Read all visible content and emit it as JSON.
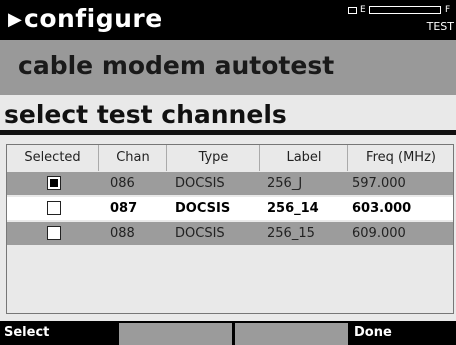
{
  "header": {
    "title": "configure",
    "battery_empty_label": "E",
    "battery_full_label": "F",
    "battery_level": 0,
    "mode_label": "TEST"
  },
  "subheader": {
    "title": "cable modem autotest"
  },
  "section": {
    "title": "select test channels"
  },
  "table": {
    "columns": [
      "Selected",
      "Chan",
      "Type",
      "Label",
      "Freq (MHz)"
    ],
    "rows": [
      {
        "selected": true,
        "chan": "086",
        "type": "DOCSIS",
        "label": "256_J",
        "freq": "597.000",
        "highlighted": false
      },
      {
        "selected": false,
        "chan": "087",
        "type": "DOCSIS",
        "label": "256_14",
        "freq": "603.000",
        "highlighted": true
      },
      {
        "selected": false,
        "chan": "088",
        "type": "DOCSIS",
        "label": "256_15",
        "freq": "609.000",
        "highlighted": false
      }
    ]
  },
  "softkeys": [
    "Select",
    "",
    "",
    "Done"
  ]
}
